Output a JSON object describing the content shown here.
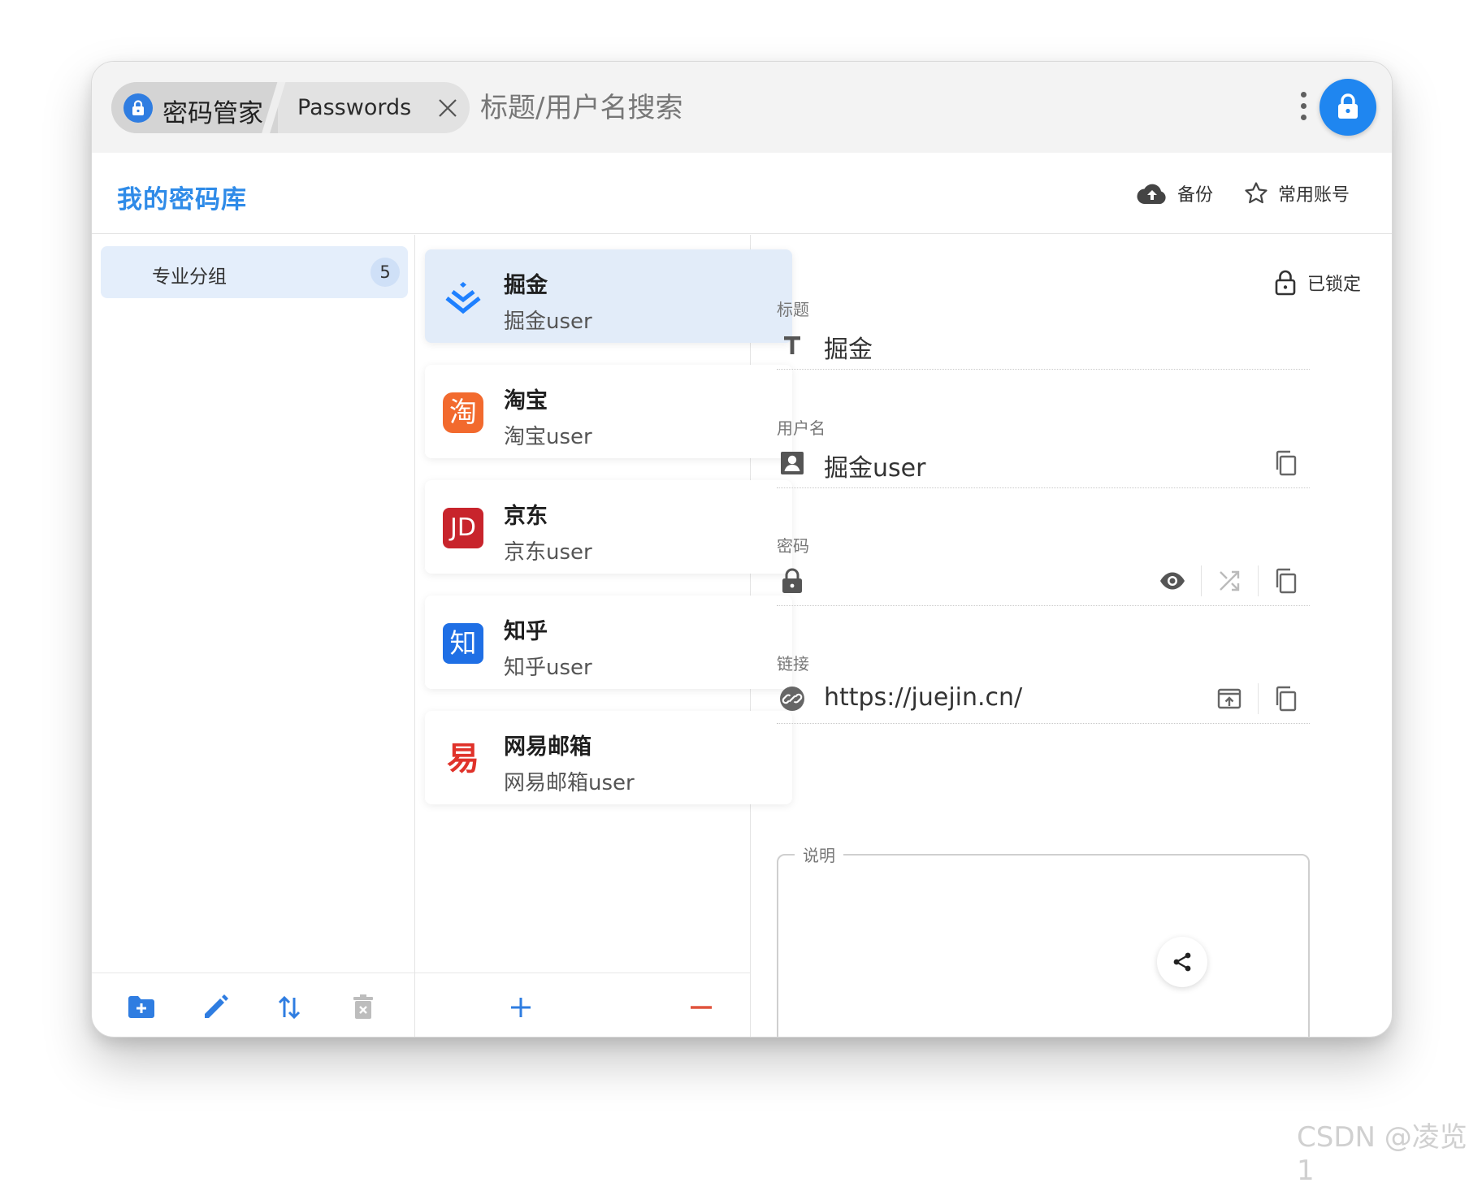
{
  "topbar": {
    "app_tab_label": "密码管家",
    "second_tab_label": "Passwords",
    "search_placeholder": "标题/用户名搜索"
  },
  "header": {
    "vault_title": "我的密码库",
    "backup_label": "备份",
    "favorites_label": "常用账号"
  },
  "groups": [
    {
      "label": "专业分组",
      "count": "5"
    }
  ],
  "entries": [
    {
      "title": "掘金",
      "username": "掘金user",
      "logo": "juejin-logo"
    },
    {
      "title": "淘宝",
      "username": "淘宝user",
      "logo": "taobao-logo"
    },
    {
      "title": "京东",
      "username": "京东user",
      "logo": "jd-logo"
    },
    {
      "title": "知乎",
      "username": "知乎user",
      "logo": "zhihu-logo"
    },
    {
      "title": "网易邮箱",
      "username": "网易邮箱user",
      "logo": "netease-mail-logo"
    }
  ],
  "logo_text": {
    "taobao": "淘",
    "jd": "JD",
    "zhihu": "知",
    "netease": "易"
  },
  "detail": {
    "lock_status": "已锁定",
    "title_label": "标题",
    "title_value": "掘金",
    "username_label": "用户名",
    "username_value": "掘金user",
    "password_label": "密码",
    "link_label": "链接",
    "link_value": "https://juejin.cn/",
    "note_label": "说明"
  },
  "colors": {
    "accent": "#2f8be8",
    "lock_button": "#1f86f0",
    "selected_bg": "#e2ecf9",
    "delete_red": "#e0533d"
  },
  "watermark": "CSDN @凌览1"
}
